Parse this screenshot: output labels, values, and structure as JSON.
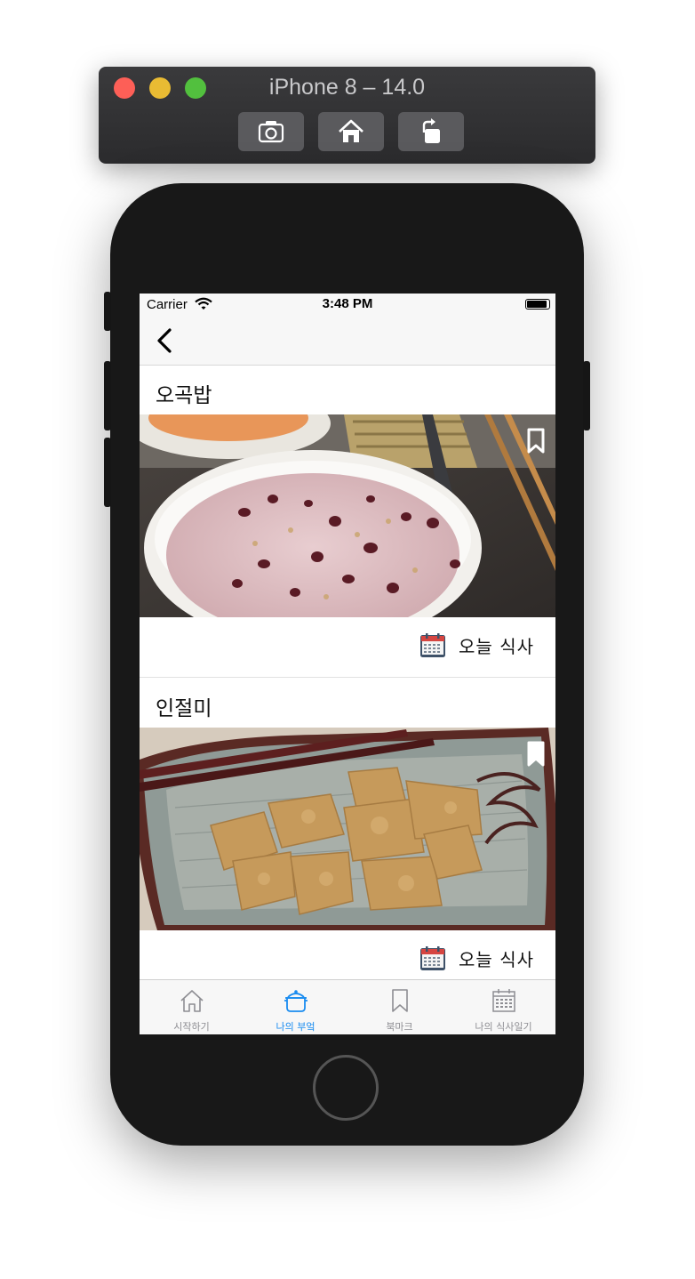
{
  "simulator": {
    "title": "iPhone 8 – 14.0",
    "buttons": [
      "screenshot-icon",
      "home-icon",
      "rotate-icon"
    ]
  },
  "status_bar": {
    "carrier": "Carrier",
    "time": "3:48 PM"
  },
  "nav": {
    "back_icon": "chevron-left-icon"
  },
  "cards": [
    {
      "title": "오곡밥",
      "action_label": "오늘 식사",
      "bookmarked": false
    },
    {
      "title": "인절미",
      "action_label": "오늘 식사",
      "bookmarked": true
    }
  ],
  "tabs": [
    {
      "label": "시작하기",
      "icon": "home-icon",
      "active": false
    },
    {
      "label": "나의 부엌",
      "icon": "pot-icon",
      "active": true
    },
    {
      "label": "북마크",
      "icon": "bookmark-icon",
      "active": false
    },
    {
      "label": "나의 식사일기",
      "icon": "calendar-icon",
      "active": false
    }
  ],
  "colors": {
    "active_tab": "#1a8cf0",
    "inactive_tab": "#8e8e93",
    "bar_background": "#f7f7f7"
  }
}
